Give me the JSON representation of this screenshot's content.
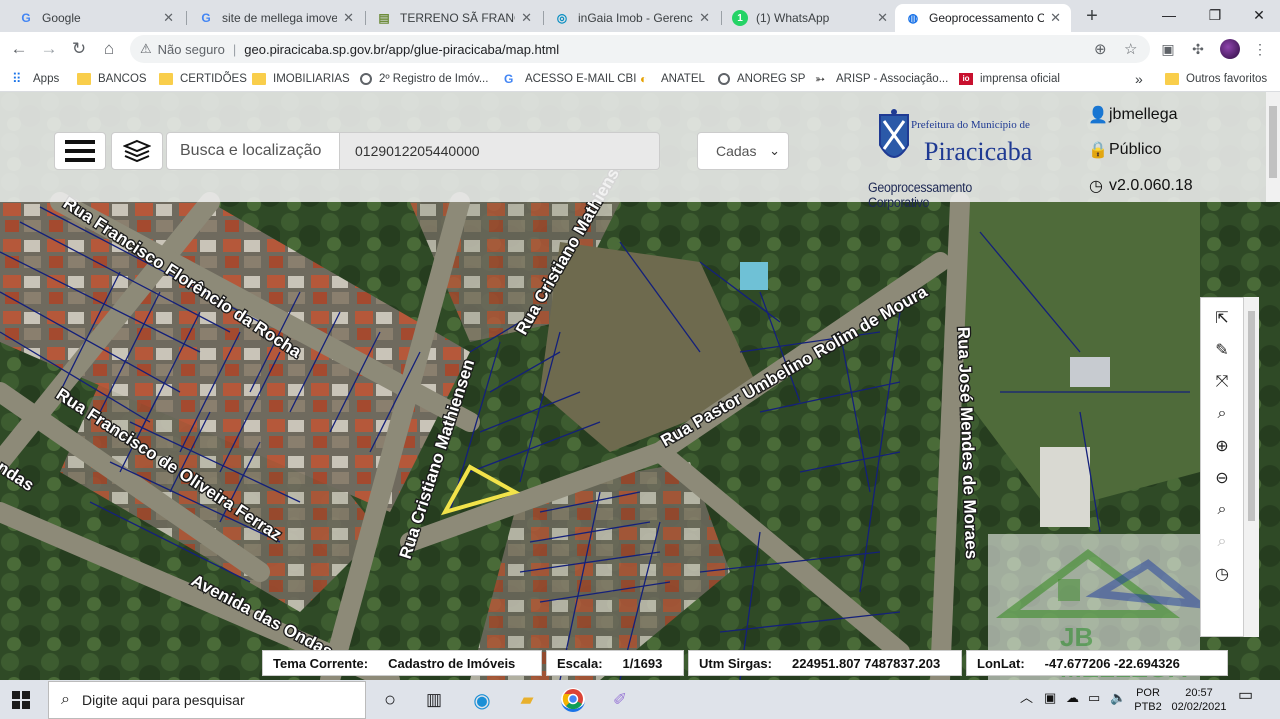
{
  "browser": {
    "tabs": [
      {
        "title": "Google",
        "icon": "google-icon",
        "active": false
      },
      {
        "title": "site de mellega imoveis",
        "icon": "google-icon",
        "active": false
      },
      {
        "title": "TERRENO SÃ FRANCISCO",
        "icon": "document-icon",
        "active": false
      },
      {
        "title": "inGaia Imob - Gerenciar",
        "icon": "ingaia-icon",
        "active": false
      },
      {
        "title": "(1) WhatsApp",
        "icon": "whatsapp-icon",
        "active": false
      },
      {
        "title": "Geoprocessamento Cor",
        "icon": "globe-icon",
        "active": true
      }
    ],
    "security_label": "Não seguro",
    "url": "geo.piracicaba.sp.gov.br/app/glue-piracicaba/map.html",
    "bookmarks": [
      {
        "label": "Apps",
        "icon": "apps-grid-icon"
      },
      {
        "label": "BANCOS",
        "icon": "folder-icon"
      },
      {
        "label": "CERTIDÕES",
        "icon": "folder-icon"
      },
      {
        "label": "IMOBILIARIAS",
        "icon": "folder-icon"
      },
      {
        "label": "2º Registro de Imóv...",
        "icon": "globe-icon"
      },
      {
        "label": "ACESSO E-MAIL CBI",
        "icon": "google-icon"
      },
      {
        "label": "ANATEL",
        "icon": "anatel-icon"
      },
      {
        "label": "ANOREG SP",
        "icon": "globe-icon"
      },
      {
        "label": "ARISP - Associação...",
        "icon": "arisp-icon"
      },
      {
        "label": "imprensa oficial",
        "icon": "io-icon"
      },
      {
        "label": "Outros favoritos",
        "icon": "folder-icon"
      }
    ],
    "overflow_label": "»"
  },
  "app": {
    "search_label": "Busca e localização",
    "search_value": "0129012205440000",
    "layer_select": "Cadas",
    "logo": {
      "line1": "Prefeitura do Município de",
      "line2": "Piracicaba",
      "line3": "Geoprocessamento Corporativo"
    },
    "user": "jbmellega",
    "access": "Público",
    "version": "v2.0.060.18",
    "watermark_text": "JB MELLEGA",
    "status": {
      "tema_key": "Tema Corrente:",
      "tema_val": "Cadastro de Imóveis",
      "escala_key": "Escala:",
      "escala_val": "1/1693",
      "utm_key": "Utm Sirgas:",
      "utm_val": "224951.807 7487837.203",
      "lonlat_key": "LonLat:",
      "lonlat_val": "-47.677206 -22.694326"
    }
  },
  "map_labels": [
    {
      "text": "Rua Francisco Florêncio da Rocha"
    },
    {
      "text": "Rua Francisco de Oliveira Ferraz"
    },
    {
      "text": "Avenida das Ondas"
    },
    {
      "text": "Rua Cristiano Mathiensen"
    },
    {
      "text": "Rua Cristiano Mathiensen"
    },
    {
      "text": "Rua Pastor Umbelino Rolim de Moura"
    },
    {
      "text": "Rua José Mendes de Moraes"
    },
    {
      "text": "ndas"
    }
  ],
  "taskbar": {
    "search_placeholder": "Digite aqui para pesquisar",
    "lang1": "POR",
    "lang2": "PTB2",
    "time": "20:57",
    "date": "02/02/2021"
  }
}
